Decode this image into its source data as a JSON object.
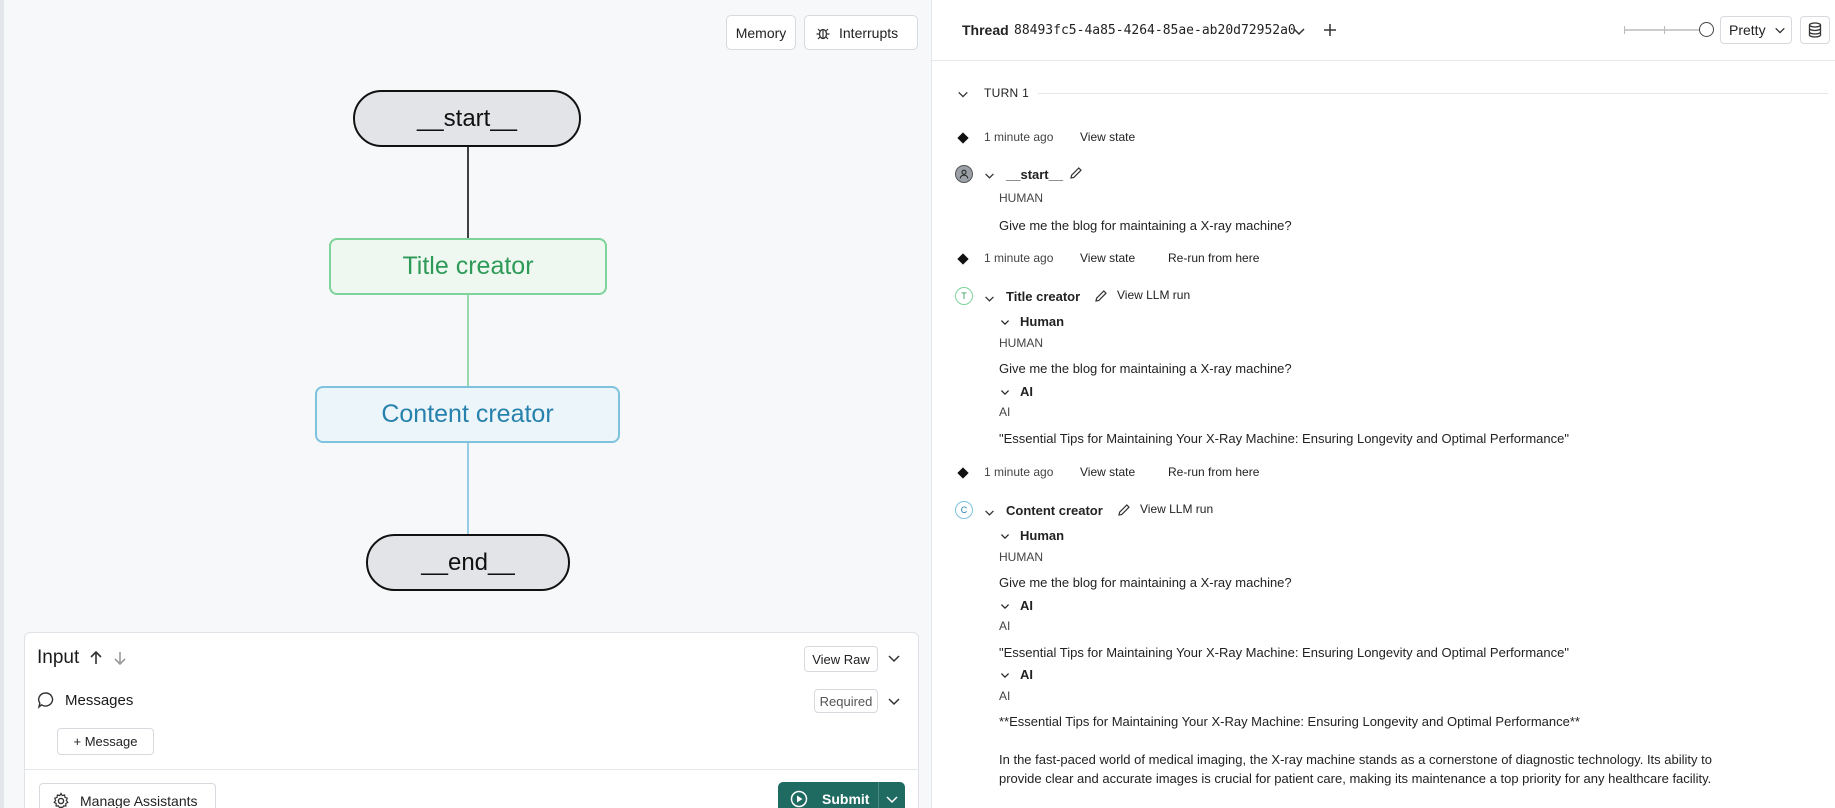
{
  "toolbar": {
    "memory_label": "Memory",
    "interrupts_label": "Interrupts"
  },
  "graph": {
    "nodes": {
      "start": "__start__",
      "title": "Title creator",
      "content": "Content creator",
      "end": "__end__"
    },
    "colors": {
      "title_edge": "#7fd39a",
      "content_edge": "#7ec2de",
      "start_edge": "#111111"
    }
  },
  "input": {
    "title": "Input",
    "view_raw_label": "View Raw",
    "messages_label": "Messages",
    "required_label": "Required",
    "add_message_label": "+ Message",
    "manage_assistants_label": "Manage Assistants",
    "submit_label": "Submit"
  },
  "thread": {
    "label": "Thread",
    "id": "88493fc5-4a85-4264-85ae-ab20d72952a0",
    "view_mode": "Pretty"
  },
  "turn": {
    "label": "TURN 1"
  },
  "events": {
    "e1": {
      "time": "1 minute ago",
      "view_state": "View state"
    },
    "start_node": {
      "name": "__start__",
      "role": "HUMAN",
      "text": "Give me the blog for maintaining a X-ray machine?"
    },
    "e2": {
      "time": "1 minute ago",
      "view_state": "View state",
      "rerun": "Re-run from here"
    },
    "title_node": {
      "badge": "T",
      "name": "Title creator",
      "view_llm": "View LLM run",
      "human_header": "Human",
      "human_role": "HUMAN",
      "human_text": "Give me the blog for maintaining a X-ray machine?",
      "ai_header": "AI",
      "ai_role": "AI",
      "ai_text": "\"Essential Tips for Maintaining Your X-Ray Machine: Ensuring Longevity and Optimal Performance\""
    },
    "e3": {
      "time": "1 minute ago",
      "view_state": "View state",
      "rerun": "Re-run from here"
    },
    "content_node": {
      "badge": "C",
      "name": "Content creator",
      "view_llm": "View LLM run",
      "human_header": "Human",
      "human_role": "HUMAN",
      "human_text": "Give me the blog for maintaining a X-ray machine?",
      "ai1_header": "AI",
      "ai1_role": "AI",
      "ai1_text": "\"Essential Tips for Maintaining Your X-Ray Machine: Ensuring Longevity and Optimal Performance\"",
      "ai2_header": "AI",
      "ai2_role": "AI",
      "ai2_text": "**Essential Tips for Maintaining Your X-Ray Machine: Ensuring Longevity and Optimal Performance**",
      "para_line1": "In the fast-paced world of medical imaging, the X-ray machine stands as a cornerstone of diagnostic technology. Its ability to",
      "para_line2": "provide clear and accurate images is crucial for patient care, making its maintenance a top priority for any healthcare facility."
    }
  }
}
